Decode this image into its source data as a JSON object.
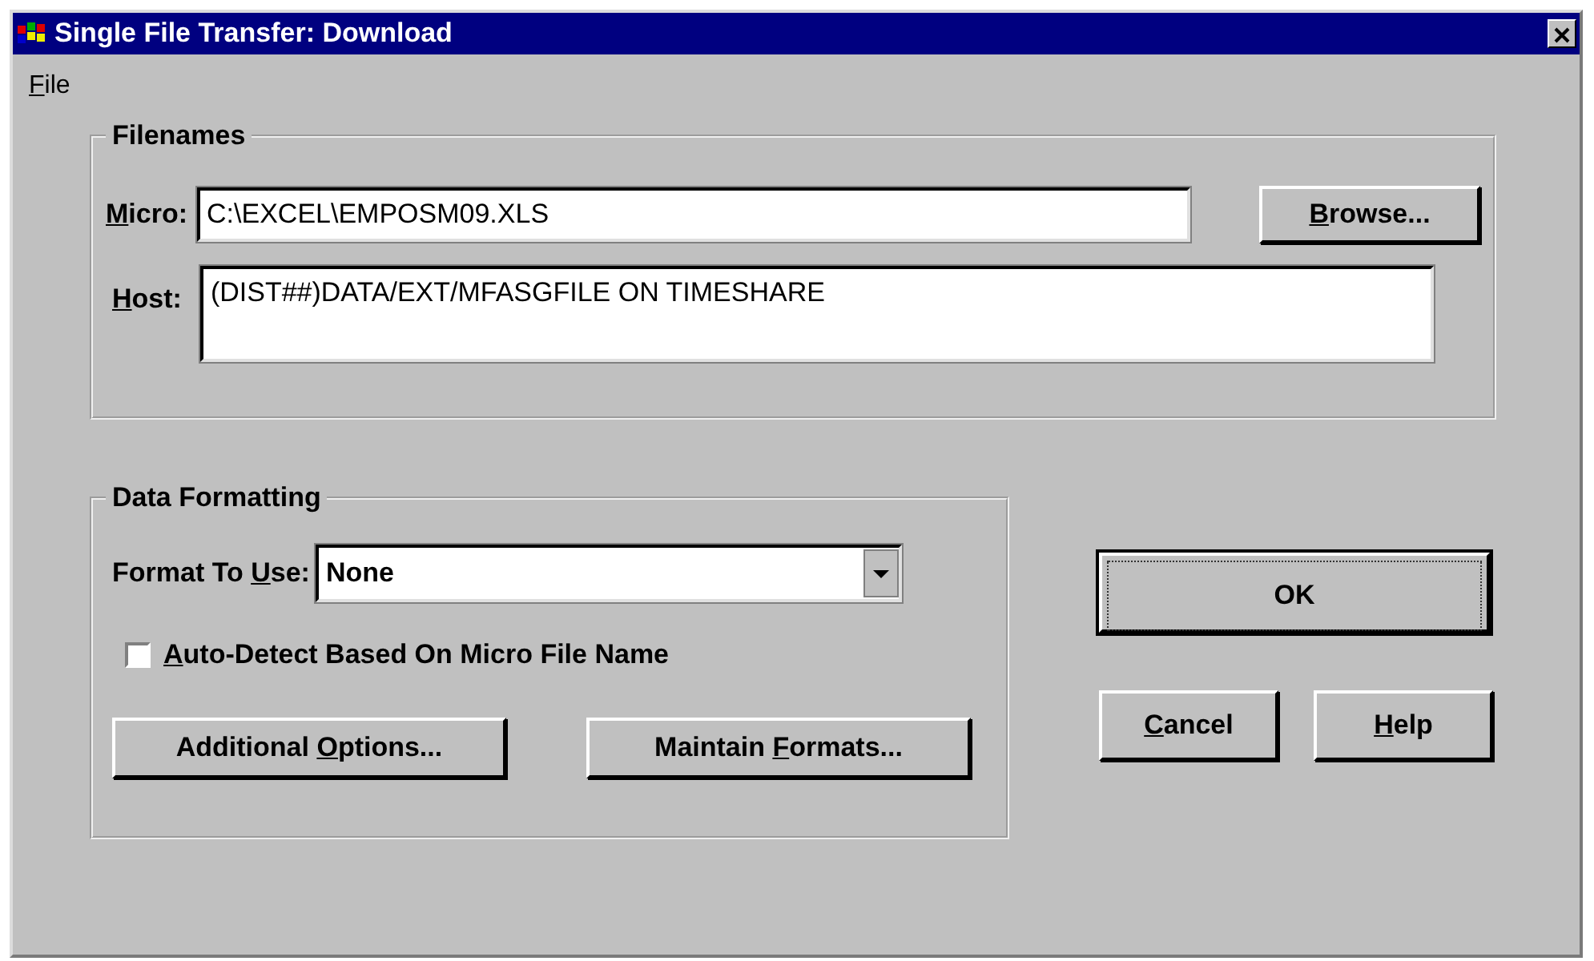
{
  "window": {
    "title": "Single File Transfer: Download"
  },
  "menu": [
    {
      "label": [
        {
          "text": "F",
          "underline": true
        },
        {
          "text": "ile",
          "underline": false
        }
      ]
    }
  ],
  "filenames": {
    "title": "Filenames",
    "micro": {
      "label": [
        {
          "text": "M",
          "underline": true
        },
        {
          "text": "icro:",
          "underline": false
        }
      ],
      "value": "C:\\EXCEL\\EMPOSM09.XLS"
    },
    "browse_button": {
      "label": [
        {
          "text": "B",
          "underline": true
        },
        {
          "text": "rowse...",
          "underline": false
        }
      ]
    },
    "host": {
      "label": [
        {
          "text": "H",
          "underline": true
        },
        {
          "text": "ost:",
          "underline": false
        }
      ],
      "value": "(DIST##)DATA/EXT/MFASGFILE ON TIMESHARE"
    }
  },
  "data_formatting": {
    "title": "Data Formatting",
    "format": {
      "label": [
        {
          "text": "Format To ",
          "underline": false
        },
        {
          "text": "U",
          "underline": true
        },
        {
          "text": "se:",
          "underline": false
        }
      ],
      "value": "None"
    },
    "auto_detect": {
      "label": [
        {
          "text": "A",
          "underline": true
        },
        {
          "text": "uto-Detect Based On Micro File Name",
          "underline": false
        }
      ],
      "checked": false
    },
    "buttons": [
      {
        "label": [
          {
            "text": "Additional ",
            "underline": false
          },
          {
            "text": "O",
            "underline": true
          },
          {
            "text": "ptions...",
            "underline": false
          }
        ]
      },
      {
        "label": [
          {
            "text": "Maintain ",
            "underline": false
          },
          {
            "text": "F",
            "underline": true
          },
          {
            "text": "ormats...",
            "underline": false
          }
        ]
      }
    ]
  },
  "dialog_buttons": [
    {
      "label": [
        {
          "text": "OK",
          "underline": false
        }
      ],
      "default": true
    },
    {
      "label": [
        {
          "text": "C",
          "underline": true
        },
        {
          "text": "ancel",
          "underline": false
        }
      ],
      "default": false
    },
    {
      "label": [
        {
          "text": "H",
          "underline": true
        },
        {
          "text": "elp",
          "underline": false
        }
      ],
      "default": false
    }
  ]
}
